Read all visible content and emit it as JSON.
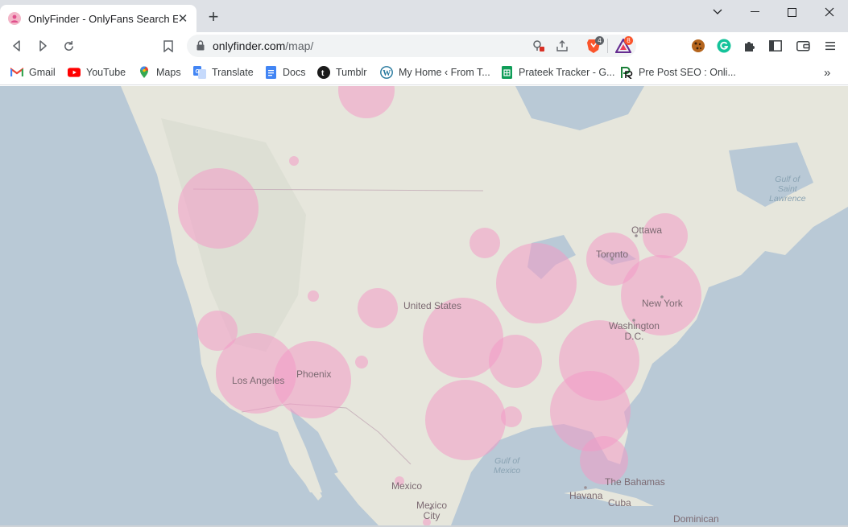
{
  "browser": {
    "tab_title": "OnlyFinder - OnlyFans Search Eng",
    "url_domain": "onlyfinder.com",
    "url_path": "/map/",
    "brave_badge": "4",
    "rewards_badge": "8"
  },
  "bookmarks": [
    {
      "label": "Gmail",
      "icon": "gmail-icon"
    },
    {
      "label": "YouTube",
      "icon": "youtube-icon"
    },
    {
      "label": "Maps",
      "icon": "maps-icon"
    },
    {
      "label": "Translate",
      "icon": "translate-icon"
    },
    {
      "label": "Docs",
      "icon": "docs-icon"
    },
    {
      "label": "Tumblr",
      "icon": "tumblr-icon"
    },
    {
      "label": "My Home ‹ From T...",
      "icon": "wordpress-icon"
    },
    {
      "label": "Prateek Tracker - G...",
      "icon": "sheets-icon"
    },
    {
      "label": "Pre Post SEO : Onli...",
      "icon": "prepostseo-icon"
    }
  ],
  "map": {
    "labels": {
      "ottawa": "Ottawa",
      "toronto": "Toronto",
      "new_york": "New York",
      "washington": "Washington\nD.C.",
      "united_states": "United States",
      "phoenix": "Phoenix",
      "los_angeles": "Los Angeles",
      "mexico": "Mexico",
      "mexico_city": "Mexico\nCity",
      "havana": "Havana",
      "cuba": "Cuba",
      "bahamas": "The Bahamas",
      "dominican": "Dominican",
      "gulf_mexico": "Gulf of\nMexico",
      "gulf_st_lawrence": "Gulf of\nSaint\nLawrence"
    },
    "circle_color": "#f39bc6",
    "land_color": "#e6e6dc",
    "water_color": "#b9c9d6"
  }
}
